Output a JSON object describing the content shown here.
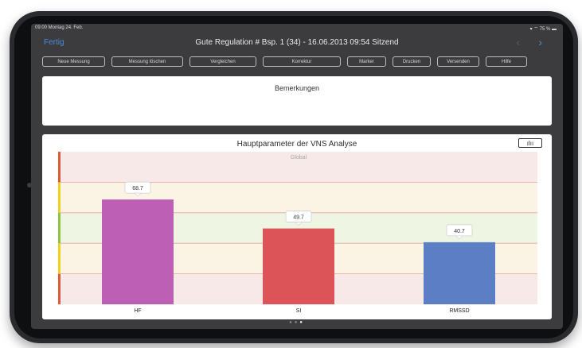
{
  "status_bar": {
    "time_date": "09:00  Montag 24. Feb.",
    "indicators": "▾ ⌔ 75 % ▬"
  },
  "navbar": {
    "done_label": "Fertig",
    "title": "Gute Regulation # Bsp. 1 (34) - 16.06.2013 09:54 Sitzend",
    "prev_icon": "chevron-left-icon",
    "next_icon": "chevron-right-icon"
  },
  "toolbar": {
    "buttons": [
      "Neue Messung",
      "Messung löschen",
      "Vergleichen",
      "Korrektur",
      "Marker",
      "Drucken",
      "Versenden",
      "Hilfe"
    ]
  },
  "remarks": {
    "title": "Bemerkungen"
  },
  "chart_panel": {
    "icon": "bar-chart-icon"
  },
  "pager": {
    "dots": 3,
    "active": 2
  },
  "colors": {
    "accent": "#4a8bd8",
    "zone_red": "#f7e9e7",
    "zone_yellow": "#fbf4e4",
    "zone_green": "#eef5e3",
    "zone_line": "#e8a59a",
    "scale_red": "#e05a3a",
    "scale_yellow": "#f0d21b",
    "scale_green": "#8cc63f"
  },
  "chart_data": {
    "type": "bar",
    "title": "Hauptparameter der VNS Analyse",
    "subtitle": "Global",
    "categories": [
      "HF",
      "SI",
      "RMSSD"
    ],
    "values": [
      68.7,
      49.7,
      40.7
    ],
    "value_labels": [
      "68.7",
      "49.7",
      "40.7"
    ],
    "colors": [
      "#bd5fb5",
      "#dc5358",
      "#5b7ec4"
    ],
    "ylim": [
      0,
      100
    ],
    "zones": [
      {
        "from": 0,
        "to": 20,
        "level": "red"
      },
      {
        "from": 20,
        "to": 40,
        "level": "yellow"
      },
      {
        "from": 40,
        "to": 60,
        "level": "green"
      },
      {
        "from": 60,
        "to": 80,
        "level": "yellow"
      },
      {
        "from": 80,
        "to": 100,
        "level": "red"
      }
    ],
    "xlabel": "",
    "ylabel": "",
    "grid": false,
    "legend": "none"
  }
}
